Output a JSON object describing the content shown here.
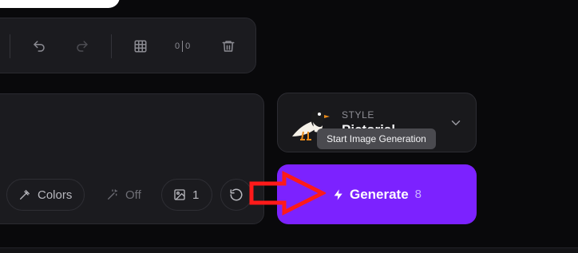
{
  "toolbar": {
    "icons": [
      "undo-icon",
      "redo-icon",
      "grid-icon",
      "aspect-ratio-icon",
      "trash-icon"
    ],
    "ratio_left": "0",
    "ratio_right": "0"
  },
  "prompt": {
    "chips": {
      "colors_label": "Colors",
      "magic_label": "Off",
      "image_count": "1"
    }
  },
  "style": {
    "label": "STYLE",
    "value": "Pictorial"
  },
  "tooltip": {
    "text": "Start Image Generation"
  },
  "generate": {
    "label": "Generate",
    "count": "8"
  },
  "colors": {
    "accent": "#7c22ff",
    "background": "#09090b",
    "panel": "#1b1b1f",
    "annotation_arrow": "#ff1a1a"
  }
}
